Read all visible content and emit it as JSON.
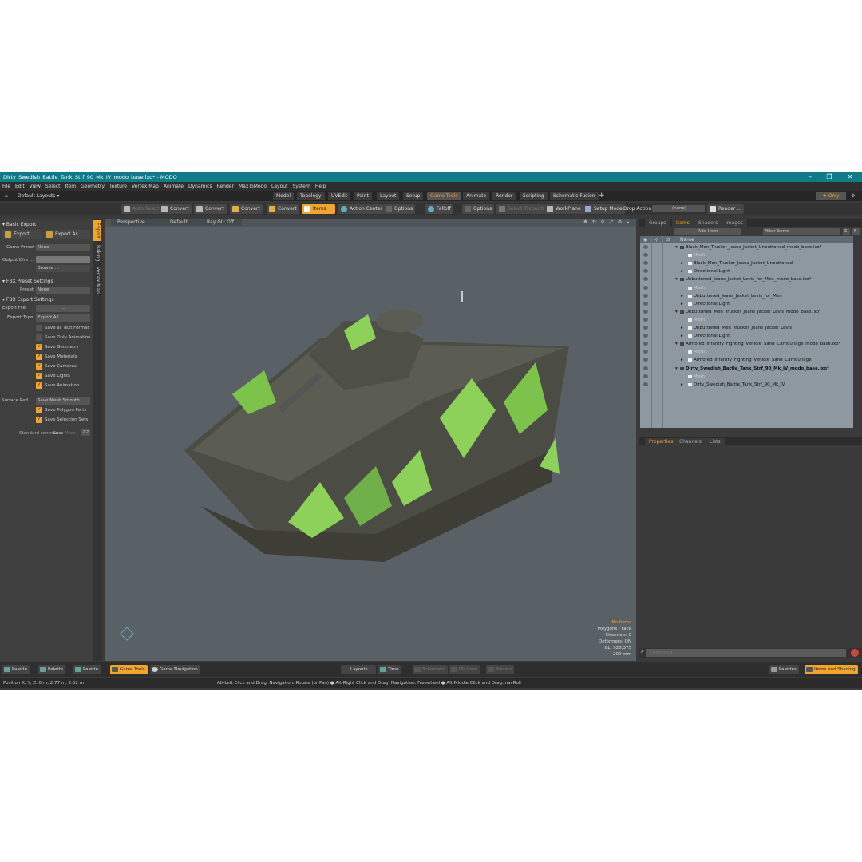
{
  "window": {
    "title": "Dirty_Swedish_Battle_Tank_Strf_90_Mk_IV_modo_base.lxo* - MODO",
    "controls": [
      "–",
      "❐",
      "✕"
    ]
  },
  "menu": [
    "File",
    "Edit",
    "View",
    "Select",
    "Item",
    "Geometry",
    "Texture",
    "Vertex Map",
    "Animate",
    "Dynamics",
    "Render",
    "MaxToModo",
    "Layout",
    "System",
    "Help"
  ],
  "layout_bar": {
    "default_layouts": "Default Layouts ▾",
    "tabs": [
      "Model",
      "Topology",
      "UVEdit",
      "Paint",
      "Layout",
      "Setup",
      "Game Tools",
      "Animate",
      "Render",
      "Scripting",
      "Schematic Fusion"
    ],
    "active_tab": "Game Tools",
    "only_label": "Only",
    "plus": "+"
  },
  "toolbar": {
    "auto_select": "Auto Select",
    "convert1": "Convert",
    "convert2": "Convert",
    "convert3": "Convert",
    "convert4": "Convert",
    "items": "Items",
    "action_center": "Action Center",
    "options1": "Options",
    "falloff": "Falloff",
    "options2": "Options",
    "select_through": "Select Through",
    "workplane": "WorkPlane",
    "setup_mode": "Setup Mode",
    "drop_action_label": "Drop Action",
    "drop_action_value": "(none)",
    "render": "Render ..."
  },
  "left_panel": {
    "vtabs": [
      "Export",
      "Baking",
      "Vertex Map"
    ],
    "basic_export": "Basic Export",
    "export_btn": "Export",
    "export_as_btn": "Export As ...",
    "game_preset_label": "Game Preset",
    "game_preset_value": "None",
    "output_dir_label": "Output Dire ...",
    "browse": "Browse ...",
    "fbx_preset_settings": "FBX Preset Settings",
    "preset_label": "Preset",
    "preset_value": "None",
    "fbx_export_settings": "FBX Export Settings",
    "export_file_label": "Export File",
    "export_file_value": "...",
    "export_type_label": "Export Type",
    "export_type_value": "Export All",
    "checkboxes": [
      {
        "label": "Save as Text Format",
        "checked": false
      },
      {
        "label": "Save Only Animation",
        "checked": false
      },
      {
        "label": "Save Geometry",
        "checked": true
      },
      {
        "label": "Save Materials",
        "checked": true
      },
      {
        "label": "Save Cameras",
        "checked": true
      },
      {
        "label": "Save Lights",
        "checked": true
      },
      {
        "label": "Save Animation",
        "checked": true
      }
    ],
    "surface_label": "Surface Refi ...",
    "surface_value": "Save Mesh Smooth ...",
    "checkboxes2": [
      {
        "label": "Save Polygon Parts",
        "checked": true
      },
      {
        "label": "Save Selection Sets",
        "checked": true
      }
    ],
    "standard_controls": "Standard controls",
    "less": "Less",
    "more": "More",
    "more_btn": ">>"
  },
  "viewport": {
    "view": "Perspective",
    "shading": "Default",
    "raygl": "Ray GL: Off",
    "info": [
      "No Items",
      "Polygons : Face",
      "Channels: 0",
      "Deformers: ON",
      "GL: 925,375",
      "200 mm"
    ],
    "colors": {
      "background": "#5a6166",
      "camo_green": "#8ed15a",
      "hull": "#4e4f46"
    }
  },
  "right_panel": {
    "tabs": [
      "Groups",
      "Items",
      "Shaders",
      "Images"
    ],
    "active_tab": "Items",
    "add_item": "Add Item",
    "filter_items": "Filter Items",
    "name_col": "Name",
    "rows": [
      {
        "indent": 0,
        "text": "Black_Men_Trucker_Jeans_Jacket_Unbuttoned_modo_base.lxo*",
        "ghost": false,
        "bold": false
      },
      {
        "indent": 1,
        "text": "Mesh",
        "ghost": true,
        "bold": false
      },
      {
        "indent": 1,
        "text": "Black_Men_Trucker_Jeans_Jacket_Unbuttoned",
        "ghost": false,
        "bold": false
      },
      {
        "indent": 1,
        "text": "Directional Light",
        "ghost": false,
        "bold": false
      },
      {
        "indent": 0,
        "text": "Unbuttoned_Jeans_Jacket_Levis_for_Men_modo_base.lxo*",
        "ghost": false,
        "bold": false
      },
      {
        "indent": 1,
        "text": "Mesh",
        "ghost": true,
        "bold": false
      },
      {
        "indent": 1,
        "text": "Unbuttoned_Jeans_Jacket_Levis_for_Men",
        "ghost": false,
        "bold": false
      },
      {
        "indent": 1,
        "text": "Directional Light",
        "ghost": false,
        "bold": false
      },
      {
        "indent": 0,
        "text": "Unbuttoned_Men_Trucker_Jeans_Jacket_Levis_modo_base.lxo*",
        "ghost": false,
        "bold": false
      },
      {
        "indent": 1,
        "text": "Mesh",
        "ghost": true,
        "bold": false
      },
      {
        "indent": 1,
        "text": "Unbuttoned_Men_Trucker_Jeans_Jacket_Levis",
        "ghost": false,
        "bold": false
      },
      {
        "indent": 1,
        "text": "Directional Light",
        "ghost": false,
        "bold": false
      },
      {
        "indent": 0,
        "text": "Armored_Infantry_Fighting_Vehicle_Sand_Camouflage_modo_base.lxo*",
        "ghost": false,
        "bold": false
      },
      {
        "indent": 1,
        "text": "Mesh",
        "ghost": true,
        "bold": false
      },
      {
        "indent": 1,
        "text": "Armored_Infantry_Fighting_Vehicle_Sand_Camouflage",
        "ghost": false,
        "bold": false
      },
      {
        "indent": 0,
        "text": "Dirty_Swedish_Battle_Tank_Strf_90_Mk_IV_modo_base.lxo*",
        "ghost": false,
        "bold": true
      },
      {
        "indent": 1,
        "text": "Mesh",
        "ghost": true,
        "bold": false
      },
      {
        "indent": 1,
        "text": "Dirty_Swedish_Battle_Tank_Strf_90_Mk_IV",
        "ghost": false,
        "bold": false
      }
    ],
    "props_tabs": [
      "Properties",
      "Channels",
      "Lists"
    ],
    "command_placeholder": "Command"
  },
  "bottom_bar": {
    "palette1": "Palette",
    "palette2": "Palette",
    "palette3": "Palette",
    "game_tools": "Game Tools",
    "game_navigation": "Game Navigation",
    "layouts": "Layouts",
    "time": "Time",
    "schematic": "Schematic",
    "uv_view": "UV View",
    "presets": "Presets",
    "palettes": "Palettes",
    "items_and_shading": "Items and Shading"
  },
  "status": {
    "position": "Position X, Y, Z:   0 m, 2.77 m, 2.52 m",
    "hint": "Alt-Left Click and Drag: Navigation: Rotate (or Pan) ● Alt-Right Click and Drag: Navigation: Freewheel ● Alt-Middle Click and Drag: navRoll"
  }
}
